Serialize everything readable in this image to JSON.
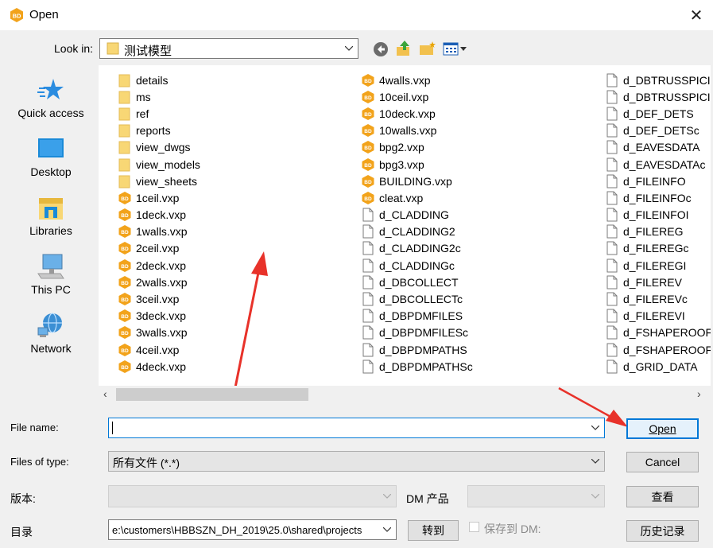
{
  "title": "Open",
  "look_in": {
    "label": "Look in:",
    "value": "测试模型"
  },
  "places": [
    {
      "label": "Quick access",
      "icon": "star-icon"
    },
    {
      "label": "Desktop",
      "icon": "desktop-icon"
    },
    {
      "label": "Libraries",
      "icon": "libraries-icon"
    },
    {
      "label": "This PC",
      "icon": "computer-icon"
    },
    {
      "label": "Network",
      "icon": "network-icon"
    }
  ],
  "files": {
    "col1": [
      {
        "name": "details",
        "type": "folder"
      },
      {
        "name": "ms",
        "type": "folder"
      },
      {
        "name": "ref",
        "type": "folder"
      },
      {
        "name": "reports",
        "type": "folder"
      },
      {
        "name": "view_dwgs",
        "type": "folder"
      },
      {
        "name": "view_models",
        "type": "folder"
      },
      {
        "name": "view_sheets",
        "type": "folder"
      },
      {
        "name": "1ceil.vxp",
        "type": "vxp"
      },
      {
        "name": "1deck.vxp",
        "type": "vxp"
      },
      {
        "name": "1walls.vxp",
        "type": "vxp"
      },
      {
        "name": "2ceil.vxp",
        "type": "vxp"
      },
      {
        "name": "2deck.vxp",
        "type": "vxp"
      },
      {
        "name": "2walls.vxp",
        "type": "vxp"
      },
      {
        "name": "3ceil.vxp",
        "type": "vxp"
      },
      {
        "name": "3deck.vxp",
        "type": "vxp"
      },
      {
        "name": "3walls.vxp",
        "type": "vxp"
      },
      {
        "name": "4ceil.vxp",
        "type": "vxp"
      },
      {
        "name": "4deck.vxp",
        "type": "vxp"
      }
    ],
    "col2": [
      {
        "name": "4walls.vxp",
        "type": "vxp"
      },
      {
        "name": "10ceil.vxp",
        "type": "vxp"
      },
      {
        "name": "10deck.vxp",
        "type": "vxp"
      },
      {
        "name": "10walls.vxp",
        "type": "vxp"
      },
      {
        "name": "bpg2.vxp",
        "type": "vxp"
      },
      {
        "name": "bpg3.vxp",
        "type": "vxp"
      },
      {
        "name": "BUILDING.vxp",
        "type": "vxp"
      },
      {
        "name": "cleat.vxp",
        "type": "vxp"
      },
      {
        "name": "d_CLADDING",
        "type": "file"
      },
      {
        "name": "d_CLADDING2",
        "type": "file"
      },
      {
        "name": "d_CLADDING2c",
        "type": "file"
      },
      {
        "name": "d_CLADDINGc",
        "type": "file"
      },
      {
        "name": "d_DBCOLLECT",
        "type": "file"
      },
      {
        "name": "d_DBCOLLECTc",
        "type": "file"
      },
      {
        "name": "d_DBPDMFILES",
        "type": "file"
      },
      {
        "name": "d_DBPDMFILESc",
        "type": "file"
      },
      {
        "name": "d_DBPDMPATHS",
        "type": "file"
      },
      {
        "name": "d_DBPDMPATHSc",
        "type": "file"
      }
    ],
    "col3": [
      {
        "name": "d_DBTRUSSPICID",
        "type": "file"
      },
      {
        "name": "d_DBTRUSSPICID",
        "type": "file"
      },
      {
        "name": "d_DEF_DETS",
        "type": "file"
      },
      {
        "name": "d_DEF_DETSc",
        "type": "file"
      },
      {
        "name": "d_EAVESDATA",
        "type": "file"
      },
      {
        "name": "d_EAVESDATAc",
        "type": "file"
      },
      {
        "name": "d_FILEINFO",
        "type": "file"
      },
      {
        "name": "d_FILEINFOc",
        "type": "file"
      },
      {
        "name": "d_FILEINFOI",
        "type": "file"
      },
      {
        "name": "d_FILEREG",
        "type": "file"
      },
      {
        "name": "d_FILEREGc",
        "type": "file"
      },
      {
        "name": "d_FILEREGI",
        "type": "file"
      },
      {
        "name": "d_FILEREV",
        "type": "file"
      },
      {
        "name": "d_FILEREVc",
        "type": "file"
      },
      {
        "name": "d_FILEREVI",
        "type": "file"
      },
      {
        "name": "d_FSHAPEROOF",
        "type": "file"
      },
      {
        "name": "d_FSHAPEROOFc",
        "type": "file"
      },
      {
        "name": "d_GRID_DATA",
        "type": "file"
      }
    ]
  },
  "file_name": {
    "label": "File name:",
    "value": ""
  },
  "file_type": {
    "label": "Files of type:",
    "value": "所有文件 (*.*)"
  },
  "version": {
    "label": "版本:",
    "value": ""
  },
  "dm_product": {
    "label": "DM 产品",
    "value": ""
  },
  "directory": {
    "label": "目录",
    "value": "e:\\customers\\HBBSZN_DH_2019\\25.0\\shared\\projects"
  },
  "buttons": {
    "open": "Open",
    "cancel": "Cancel",
    "view": "查看",
    "goto": "转到",
    "history": "历史记录"
  },
  "save_to_dm": "保存到 DM:",
  "colors": {
    "accent": "#0078d7",
    "arrow": "#e8322a",
    "vxp_icon": "#f2a31b",
    "folder": "#f8d775"
  }
}
